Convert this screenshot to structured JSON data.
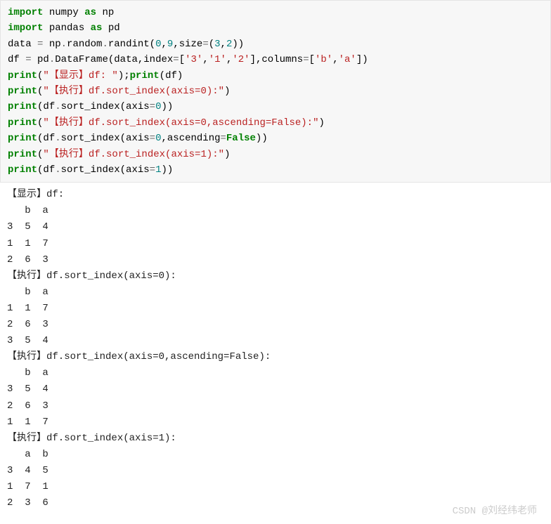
{
  "code": {
    "l1_kw1": "import",
    "l1_mod": "numpy",
    "l1_kw2": "as",
    "l1_alias": "np",
    "l2_kw1": "import",
    "l2_mod": "pandas",
    "l2_kw2": "as",
    "l2_alias": "pd",
    "l3_a": "data ",
    "l3_eq": "=",
    "l3_b": " np",
    "l3_dot1": ".",
    "l3_c": "random",
    "l3_dot2": ".",
    "l3_d": "randint(",
    "l3_n1": "0",
    "l3_c1": ",",
    "l3_n2": "9",
    "l3_c2": ",size",
    "l3_eq2": "=",
    "l3_p": "(",
    "l3_n3": "3",
    "l3_c3": ",",
    "l3_n4": "2",
    "l3_end": "))",
    "l4_a": "df ",
    "l4_eq": "=",
    "l4_b": " pd",
    "l4_dot": ".",
    "l4_c": "DataFrame(data,index",
    "l4_eq2": "=",
    "l4_br": "[",
    "l4_s1": "'3'",
    "l4_c1": ",",
    "l4_s2": "'1'",
    "l4_c2": ",",
    "l4_s3": "'2'",
    "l4_br2": "],columns",
    "l4_eq3": "=",
    "l4_br3": "[",
    "l4_s4": "'b'",
    "l4_c3": ",",
    "l4_s5": "'a'",
    "l4_end": "])",
    "l5_p1": "print",
    "l5_op": "(",
    "l5_s": "\"【显示】df: \"",
    "l5_cl": ");",
    "l5_p2": "print",
    "l5_op2": "(df)",
    "l6_p": "print",
    "l6_op": "(",
    "l6_s": "\"【执行】df.sort_index(axis=0):\"",
    "l6_cl": ")",
    "l7_p": "print",
    "l7_a": "(df",
    "l7_dot": ".",
    "l7_b": "sort_index(axis",
    "l7_eq": "=",
    "l7_n": "0",
    "l7_end": "))",
    "l8_p": "print",
    "l8_op": "(",
    "l8_s": "\"【执行】df.sort_index(axis=0,ascending=False):\"",
    "l8_cl": ")",
    "l9_p": "print",
    "l9_a": "(df",
    "l9_dot": ".",
    "l9_b": "sort_index(axis",
    "l9_eq": "=",
    "l9_n": "0",
    "l9_c": ",ascending",
    "l9_eq2": "=",
    "l9_f": "False",
    "l9_end": "))",
    "l10_p": "print",
    "l10_op": "(",
    "l10_s": "\"【执行】df.sort_index(axis=1):\"",
    "l10_cl": ")",
    "l11_p": "print",
    "l11_a": "(df",
    "l11_dot": ".",
    "l11_b": "sort_index(axis",
    "l11_eq": "=",
    "l11_n": "1",
    "l11_end": "))"
  },
  "output": {
    "h1": "【显示】df:",
    "hdr_ba": "   b  a",
    "r_3_5_4": "3  5  4",
    "r_1_1_7": "1  1  7",
    "r_2_6_3": "2  6  3",
    "h2": "【执行】df.sort_index(axis=0):",
    "r1_1_7": "1  1  7",
    "r2_6_3": "2  6  3",
    "r3_5_4": "3  5  4",
    "h3": "【执行】df.sort_index(axis=0,ascending=False):",
    "d3_5_4": "3  5  4",
    "d2_6_3": "2  6  3",
    "d1_1_7": "1  1  7",
    "h4": "【执行】df.sort_index(axis=1):",
    "hdr_ab": "   a  b",
    "e3_4_5": "3  4  5",
    "e1_7_1": "1  7  1",
    "e2_3_6": "2  3  6"
  },
  "watermark": "CSDN @刘经纬老师"
}
